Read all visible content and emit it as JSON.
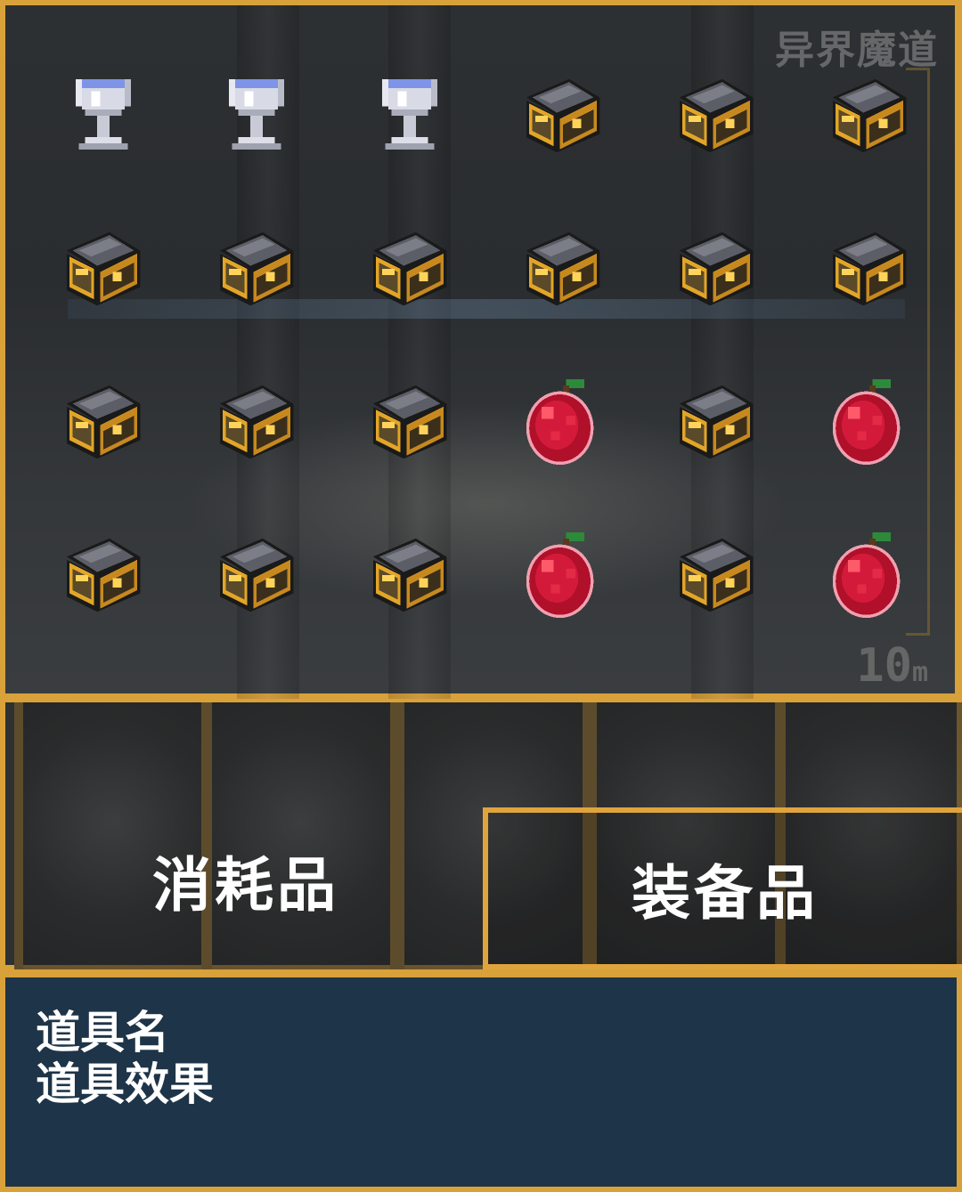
{
  "inventory": {
    "watermark": "异界魔道",
    "depth_value": "10",
    "depth_unit": "m",
    "rows": [
      [
        "silver-goblet",
        "silver-goblet",
        "silver-goblet",
        "treasure-chest",
        "treasure-chest",
        "treasure-chest"
      ],
      [
        "treasure-chest",
        "treasure-chest",
        "treasure-chest",
        "treasure-chest",
        "treasure-chest",
        "treasure-chest"
      ],
      [
        "treasure-chest",
        "treasure-chest",
        "treasure-chest",
        "red-apple",
        "treasure-chest",
        "red-apple"
      ],
      [
        "treasure-chest",
        "treasure-chest",
        "treasure-chest",
        "red-apple",
        "treasure-chest",
        "red-apple"
      ]
    ]
  },
  "tabs": {
    "consumables_label": "消耗品",
    "equipment_label": "装备品",
    "selected": "equipment"
  },
  "description": {
    "item_name": "道具名",
    "item_effect": "道具效果"
  },
  "colors": {
    "frame_gold": "#d9a13a",
    "desc_bg": "#1e3448"
  }
}
